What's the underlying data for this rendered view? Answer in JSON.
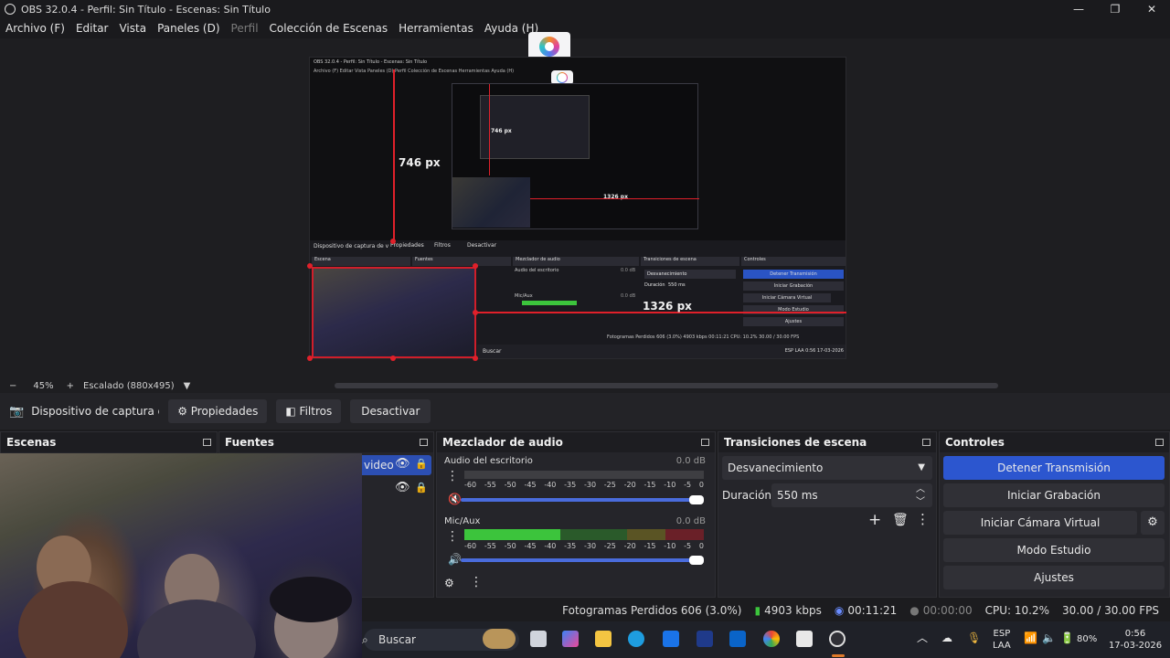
{
  "window": {
    "title": "OBS 32.0.4 - Perfil: Sin Título - Escenas: Sin Título",
    "controls": [
      "—",
      "❐",
      "✕"
    ]
  },
  "menu": [
    "Archivo (F)",
    "Editar",
    "Vista",
    "Paneles (D)",
    "Perfil",
    "Colección de Escenas",
    "Herramientas",
    "Ayuda (H)"
  ],
  "menu_disabled_index": 4,
  "preview": {
    "dim_vertical": "746 px",
    "dim_horizontal": "1326 px",
    "nested": {
      "title": "OBS 32.0.4 - Perfil: Sin Título - Escenas: Sin Título",
      "menu": "Archivo (F)   Editar   Vista   Paneles (D)   Perfil   Colección de Escenas   Herramientas   Ayuda (H)",
      "inner_dim_vertical": "746 px",
      "inner_dim_horizontal": "1326 px",
      "toolbar": "Dispositivo de captura de v",
      "tabs": [
        "Propiedades",
        "Filtros",
        "Desactivar"
      ],
      "panels": [
        "Escena",
        "Fuentes",
        "Mezclador de audio",
        "Transiciones de escena",
        "Controles"
      ],
      "channel1": "Audio del escritorio",
      "channel2": "Mic/Aux",
      "db": "0.0 dB",
      "transition": "Desvanecimiento",
      "duration_label": "Duración",
      "duration_value": "550 ms",
      "buttons": [
        "Detener Transmisión",
        "Iniciar Grabación",
        "Iniciar Cámara Virtual",
        "Modo Estudio",
        "Ajustes"
      ],
      "status": "Fotogramas Perdidos 606 (3.0%)    4903 kbps    00:11:21    CPU: 10.2%    30.00 / 30.00 FPS",
      "search": "Buscar",
      "tray": "ESP LAA   0:56 17-03-2026"
    }
  },
  "zoom": {
    "minus": "−",
    "value": "45%",
    "plus": "+",
    "scale": "Escalado (880x495)"
  },
  "source_toolbar": {
    "source_name": "Dispositivo de captura de v",
    "properties": "Propiedades",
    "filters": "Filtros",
    "deactivate": "Desactivar"
  },
  "docks": {
    "scenes": {
      "title": "Escenas"
    },
    "sources": {
      "title": "Fuentes",
      "item_label": "video"
    },
    "mixer": {
      "title": "Mezclador de audio",
      "channels": [
        {
          "name": "Audio del escritorio",
          "db": "0.0 dB",
          "level": 0.0
        },
        {
          "name": "Mic/Aux",
          "db": "0.0 dB",
          "level": 0.4
        }
      ],
      "ticks": [
        "-60",
        "-55",
        "-50",
        "-45",
        "-40",
        "-35",
        "-30",
        "-25",
        "-20",
        "-15",
        "-10",
        "-5",
        "0"
      ]
    },
    "transitions": {
      "title": "Transiciones de escena",
      "selected": "Desvanecimiento",
      "duration_label": "Duración",
      "duration_value": "550 ms"
    },
    "controls": {
      "title": "Controles",
      "stop_stream": "Detener Transmisión",
      "start_recording": "Iniciar Grabación",
      "start_virtual_cam": "Iniciar Cámara Virtual",
      "studio_mode": "Modo Estudio",
      "settings": "Ajustes"
    }
  },
  "status": {
    "dropped_frames": "Fotogramas Perdidos 606 (3.0%)",
    "bitrate": "4903 kbps",
    "stream_time": "00:11:21",
    "record_time": "00:00:00",
    "cpu": "CPU: 10.2%",
    "fps": "30.00 / 30.00 FPS"
  },
  "taskbar": {
    "search": "Buscar",
    "lang_top": "ESP",
    "lang_bottom": "LAA",
    "battery": "80%",
    "time": "0:56",
    "date": "17-03-2026"
  },
  "colors": {
    "accent": "#2c56cf",
    "meter_green": "#3cc43c",
    "meter_yellow": "#c8b42c",
    "meter_red": "#c8283a",
    "guide_red": "#e0202a"
  }
}
